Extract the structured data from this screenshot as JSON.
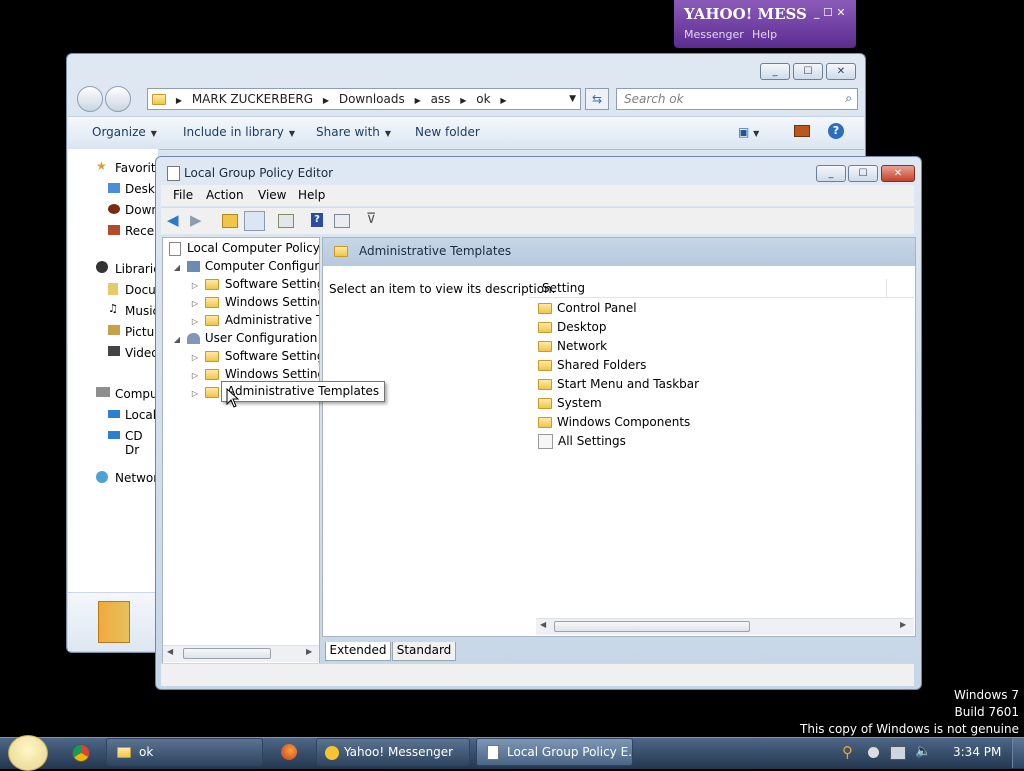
{
  "yahoo": {
    "logo": "YAHOO! MESS",
    "menu": [
      "Messenger",
      "Help"
    ]
  },
  "explorer": {
    "breadcrumb": [
      "MARK ZUCKERBERG",
      "Downloads",
      "ass",
      "ok"
    ],
    "search_placeholder": "Search ok",
    "toolbar": {
      "organize": "Organize",
      "include": "Include in library",
      "share": "Share with",
      "newfolder": "New folder"
    },
    "nav": [
      "Favorite",
      "Deskt",
      "Down",
      "Recer",
      "Librarie",
      "Docu",
      "Music",
      "Pictu",
      "Video",
      "Compu",
      "Local",
      "CD Dr",
      "Networ"
    ]
  },
  "gpe": {
    "title": "Local Group Policy Editor",
    "menu": [
      "File",
      "Action",
      "View",
      "Help"
    ],
    "tree": {
      "root": "Local Computer Policy",
      "computer": "Computer Configura",
      "computer_children": [
        "Software Settings",
        "Windows Setting",
        "Administrative Te"
      ],
      "user": "User Configuration",
      "user_children": [
        "Software Settings",
        "Windows Setting"
      ]
    },
    "tooltip": "Administrative Templates",
    "header": "Administrative Templates",
    "description": "Select an item to view its description.",
    "column": "Setting",
    "settings": [
      "Control Panel",
      "Desktop",
      "Network",
      "Shared Folders",
      "Start Menu and Taskbar",
      "System",
      "Windows Components",
      "All Settings"
    ],
    "tabs": [
      "Extended",
      "Standard"
    ]
  },
  "watermark": [
    "Windows 7",
    "Build 7601",
    "This copy of Windows is not genuine"
  ],
  "taskbar": {
    "items": [
      "ok",
      "Yahoo! Messenger",
      "Local Group Policy E..."
    ],
    "time": "3:34 PM"
  }
}
